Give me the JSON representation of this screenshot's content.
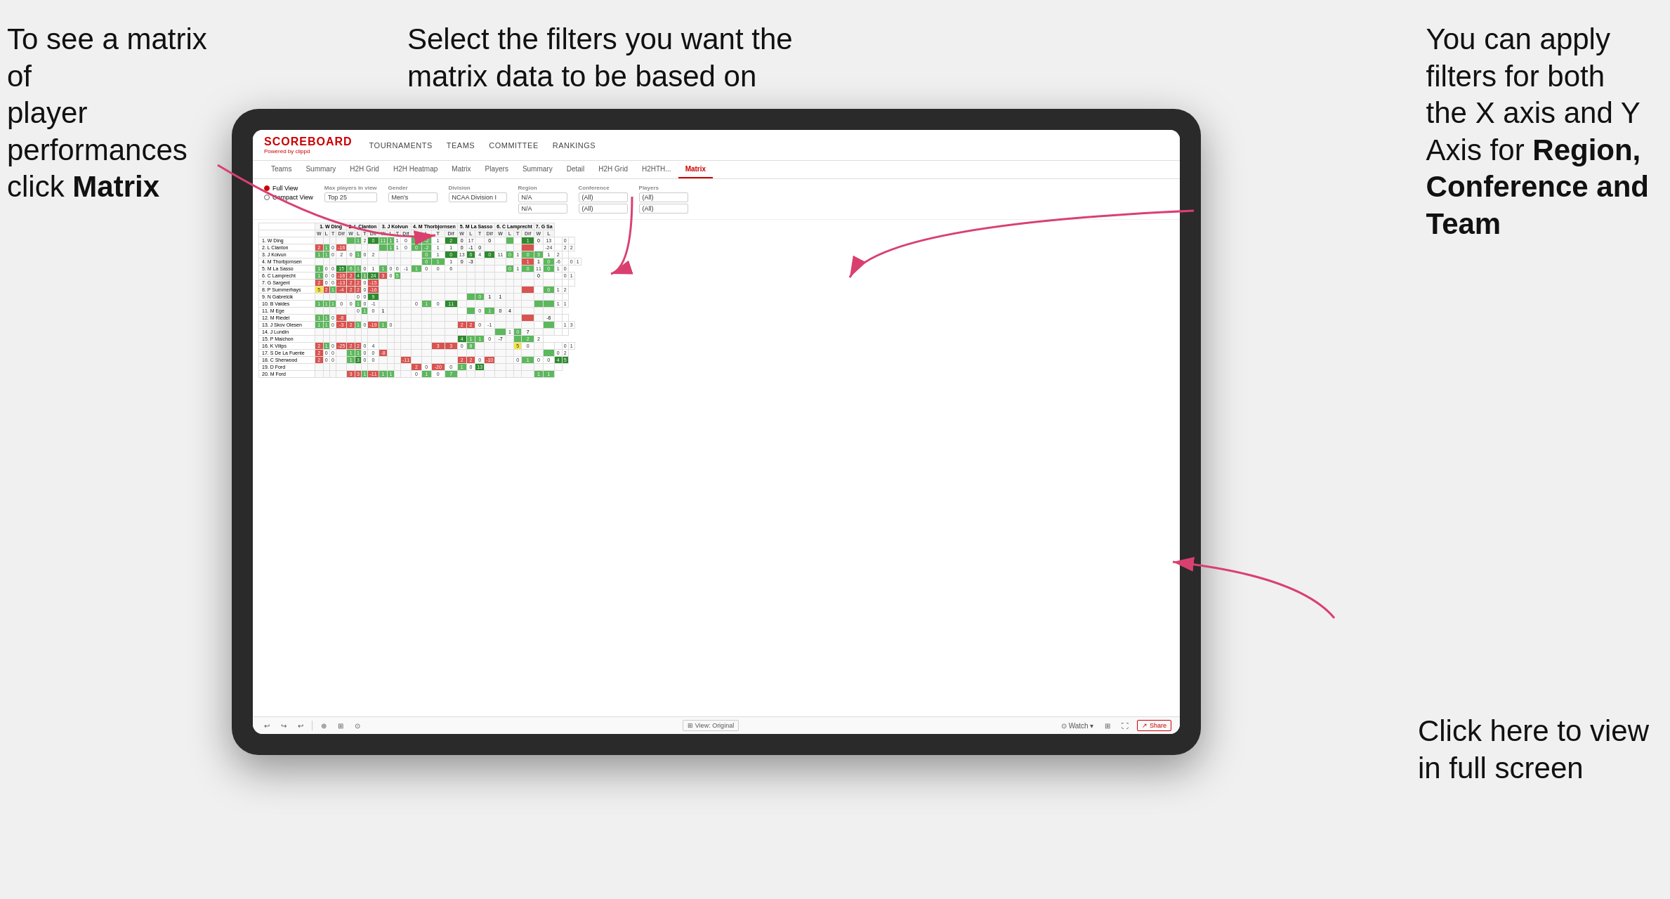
{
  "annotations": {
    "top_left": {
      "line1": "To see a matrix of",
      "line2": "player performances",
      "line3_pre": "click ",
      "line3_bold": "Matrix"
    },
    "top_center": {
      "line1": "Select the filters you want the",
      "line2": "matrix data to be based on"
    },
    "top_right": {
      "line1": "You  can apply",
      "line2": "filters for both",
      "line3": "the X axis and Y",
      "line4_pre": "Axis for ",
      "line4_bold": "Region,",
      "line5_bold": "Conference and",
      "line6_bold": "Team"
    },
    "bottom_right": {
      "line1": "Click here to view",
      "line2": "in full screen"
    }
  },
  "app": {
    "logo_main": "SCOREBOARD",
    "logo_sub_pre": "Powered by ",
    "logo_sub_brand": "clippd",
    "nav_items": [
      "TOURNAMENTS",
      "TEAMS",
      "COMMITTEE",
      "RANKINGS"
    ],
    "sub_nav_items": [
      "Teams",
      "Summary",
      "H2H Grid",
      "H2H Heatmap",
      "Matrix",
      "Players",
      "Summary",
      "Detail",
      "H2H Grid",
      "H2HTH...",
      "Matrix"
    ],
    "active_tab": "Matrix"
  },
  "filters": {
    "view_full": "Full View",
    "view_compact": "Compact View",
    "max_players_label": "Max players in view",
    "max_players_value": "Top 25",
    "gender_label": "Gender",
    "gender_value": "Men's",
    "division_label": "Division",
    "division_value": "NCAA Division I",
    "region_label": "Region",
    "region_value": "N/A",
    "region_value2": "N/A",
    "conference_label": "Conference",
    "conference_value": "(All)",
    "conference_value2": "(All)",
    "players_label": "Players",
    "players_value": "(All)",
    "players_value2": "(All)"
  },
  "column_headers": [
    {
      "name": "1. W Ding",
      "sub": [
        "W",
        "L",
        "T",
        "Dif"
      ]
    },
    {
      "name": "2. L Clanton",
      "sub": [
        "W",
        "L",
        "T",
        "Dif"
      ]
    },
    {
      "name": "3. J Koivun",
      "sub": [
        "W",
        "L",
        "T",
        "Dif"
      ]
    },
    {
      "name": "4. M Thorbjornsen",
      "sub": [
        "W",
        "L",
        "T",
        "Dif"
      ]
    },
    {
      "name": "5. M La Sasso",
      "sub": [
        "W",
        "L",
        "T",
        "Dif"
      ]
    },
    {
      "name": "6. C Lamprecht",
      "sub": [
        "W",
        "L",
        "T",
        "Dif"
      ]
    },
    {
      "name": "7. G Sa",
      "sub": [
        "W",
        "L"
      ]
    }
  ],
  "rows": [
    {
      "name": "1. W Ding",
      "cells": [
        "",
        "",
        "",
        "",
        "",
        "1",
        "2",
        "0",
        "11",
        "1",
        "1",
        "0",
        "0",
        "-2",
        "1",
        "2",
        "0",
        "17",
        "",
        "0",
        "",
        "",
        "",
        "1",
        "0",
        "13",
        "",
        "0",
        ""
      ]
    },
    {
      "name": "2. L Clanton",
      "cells": [
        "2",
        "1",
        "0",
        "-16",
        "",
        "",
        "",
        "",
        "",
        "1",
        "1",
        "0",
        "0",
        "-2",
        "1",
        "1",
        "0",
        "-1",
        "0",
        "",
        "",
        "",
        "",
        "",
        "",
        "-24",
        "",
        "2",
        "2"
      ]
    },
    {
      "name": "3. J Koivun",
      "cells": [
        "1",
        "1",
        "0",
        "2",
        "0",
        "1",
        "0",
        "2",
        "",
        "",
        "",
        "",
        "",
        "0",
        "1",
        "0",
        "13",
        "0",
        "4",
        "0",
        "11",
        "0",
        "1",
        "0",
        "3",
        "1",
        "2",
        ""
      ]
    },
    {
      "name": "4. M Thorbjornsen",
      "cells": [
        "",
        "",
        "",
        "",
        "",
        "",
        "",
        "",
        "",
        "",
        "",
        "",
        "",
        "0",
        "1",
        "1",
        "0",
        "-3",
        "",
        "",
        "",
        "",
        "",
        "1",
        "1",
        "0",
        "-6",
        "",
        "0",
        "1"
      ]
    },
    {
      "name": "5. M La Sasso",
      "cells": [
        "1",
        "0",
        "0",
        "15",
        "6",
        "1",
        "0",
        "1",
        "1",
        "0",
        "0",
        "-1",
        "1",
        "0",
        "0",
        "6",
        "",
        "",
        "",
        "",
        "",
        "0",
        "1",
        "0",
        "11",
        "0",
        "1",
        "0"
      ]
    },
    {
      "name": "6. C Lamprecht",
      "cells": [
        "1",
        "0",
        "0",
        "-16",
        "2",
        "4",
        "1",
        "24",
        "3",
        "0",
        "5",
        "",
        "",
        "",
        "",
        "",
        "",
        "",
        "",
        "",
        "",
        "",
        "",
        "",
        "0",
        "",
        "",
        "0",
        "1"
      ]
    },
    {
      "name": "7. G Sargent",
      "cells": [
        "2",
        "0",
        "0",
        "-13",
        "2",
        "2",
        "0",
        "-15",
        "",
        "",
        "",
        "",
        "",
        "",
        "",
        "",
        "",
        "",
        "",
        "",
        "",
        "",
        "",
        "",
        "",
        "",
        "",
        "",
        ""
      ]
    },
    {
      "name": "8. P Summerhays",
      "cells": [
        "5",
        "2",
        "1",
        "-4",
        "2",
        "2",
        "0",
        "-16",
        "",
        "",
        "",
        "",
        "",
        "",
        "",
        "",
        "",
        "",
        "",
        "",
        "",
        "",
        "",
        "",
        "",
        "0",
        "1",
        "2"
      ]
    },
    {
      "name": "9. N Gabrelcik",
      "cells": [
        "",
        "",
        "",
        "",
        "",
        "0",
        "0",
        "9",
        "",
        "",
        "",
        "",
        "",
        "",
        "",
        "",
        "",
        "",
        "0",
        "1",
        "1",
        "",
        "",
        "",
        "",
        "",
        "",
        ""
      ]
    },
    {
      "name": "10. B Valdes",
      "cells": [
        "1",
        "1",
        "1",
        "0",
        "0",
        "1",
        "0",
        "-1",
        "",
        "",
        "",
        "",
        "0",
        "1",
        "0",
        "11",
        "",
        "",
        "",
        "",
        "",
        "",
        "",
        "",
        "",
        "",
        "1",
        "1"
      ]
    },
    {
      "name": "11. M Ege",
      "cells": [
        "",
        "",
        "",
        "",
        "",
        "0",
        "1",
        "0",
        "1",
        "",
        "",
        "",
        "",
        "",
        "",
        "",
        "",
        "",
        "0",
        "1",
        "0",
        "4",
        "",
        "",
        "",
        "",
        ""
      ]
    },
    {
      "name": "12. M Riedel",
      "cells": [
        "1",
        "1",
        "0",
        "-6",
        "",
        "",
        "",
        "",
        "",
        "",
        "",
        "",
        "",
        "",
        "",
        "",
        "",
        "",
        "",
        "",
        "",
        "",
        "",
        "",
        "",
        "-6",
        "",
        ""
      ]
    },
    {
      "name": "13. J Skov Olesen",
      "cells": [
        "1",
        "1",
        "0",
        "-3",
        "2",
        "1",
        "0",
        "-19",
        "1",
        "0",
        "",
        "",
        "",
        "",
        "",
        "",
        "2",
        "2",
        "0",
        "-1",
        "",
        "",
        "",
        "",
        "",
        "",
        "",
        "1",
        "3"
      ]
    },
    {
      "name": "14. J Lundin",
      "cells": [
        "",
        "",
        "",
        "",
        "",
        "",
        "",
        "",
        "",
        "",
        "",
        "",
        "",
        "",
        "",
        "",
        "",
        "",
        "",
        "",
        "",
        "1",
        "0",
        "7",
        "",
        "",
        "",
        ""
      ]
    },
    {
      "name": "15. P Maichon",
      "cells": [
        "",
        "",
        "",
        "",
        "",
        "",
        "",
        "",
        "",
        "",
        "",
        "",
        "",
        "",
        "",
        "",
        "4",
        "1",
        "1",
        "0",
        "-7",
        "",
        "",
        "2",
        "2"
      ]
    },
    {
      "name": "16. K Vilips",
      "cells": [
        "2",
        "1",
        "0",
        "-25",
        "2",
        "2",
        "0",
        "4",
        "",
        "",
        "",
        "",
        "",
        "",
        "3",
        "3",
        "0",
        "8",
        "",
        "",
        "",
        "",
        "5",
        "0",
        "",
        "",
        "",
        "0",
        "1"
      ]
    },
    {
      "name": "17. S De La Fuente",
      "cells": [
        "2",
        "0",
        "0",
        "",
        "1",
        "1",
        "0",
        "0",
        "-8",
        "",
        "",
        "",
        "",
        "",
        "",
        "",
        "",
        "",
        "",
        "",
        "",
        "",
        "",
        "",
        "",
        "",
        "0",
        "2"
      ]
    },
    {
      "name": "18. C Sherwood",
      "cells": [
        "2",
        "0",
        "0",
        "",
        "1",
        "3",
        "0",
        "0",
        "",
        "",
        "",
        "-11",
        "",
        "",
        "",
        "",
        "2",
        "2",
        "0",
        "-10",
        "",
        "",
        "0",
        "1",
        "0",
        "0",
        "4",
        "5"
      ]
    },
    {
      "name": "19. D Ford",
      "cells": [
        "",
        "",
        "",
        "",
        "",
        "",
        "",
        "",
        "",
        "",
        "",
        "",
        "2",
        "0",
        "-20",
        "0",
        "1",
        "0",
        "13",
        "",
        "",
        "",
        "",
        "",
        "",
        "",
        ""
      ]
    },
    {
      "name": "20. M Ford",
      "cells": [
        "",
        "",
        "",
        "",
        "3",
        "3",
        "1",
        "-11",
        "1",
        "1",
        "",
        "",
        "0",
        "1",
        "0",
        "7",
        "",
        "",
        "",
        "",
        "",
        "",
        "",
        "",
        "1",
        "1"
      ]
    }
  ],
  "toolbar": {
    "view_original": "View: Original",
    "watch": "Watch",
    "share": "Share"
  }
}
